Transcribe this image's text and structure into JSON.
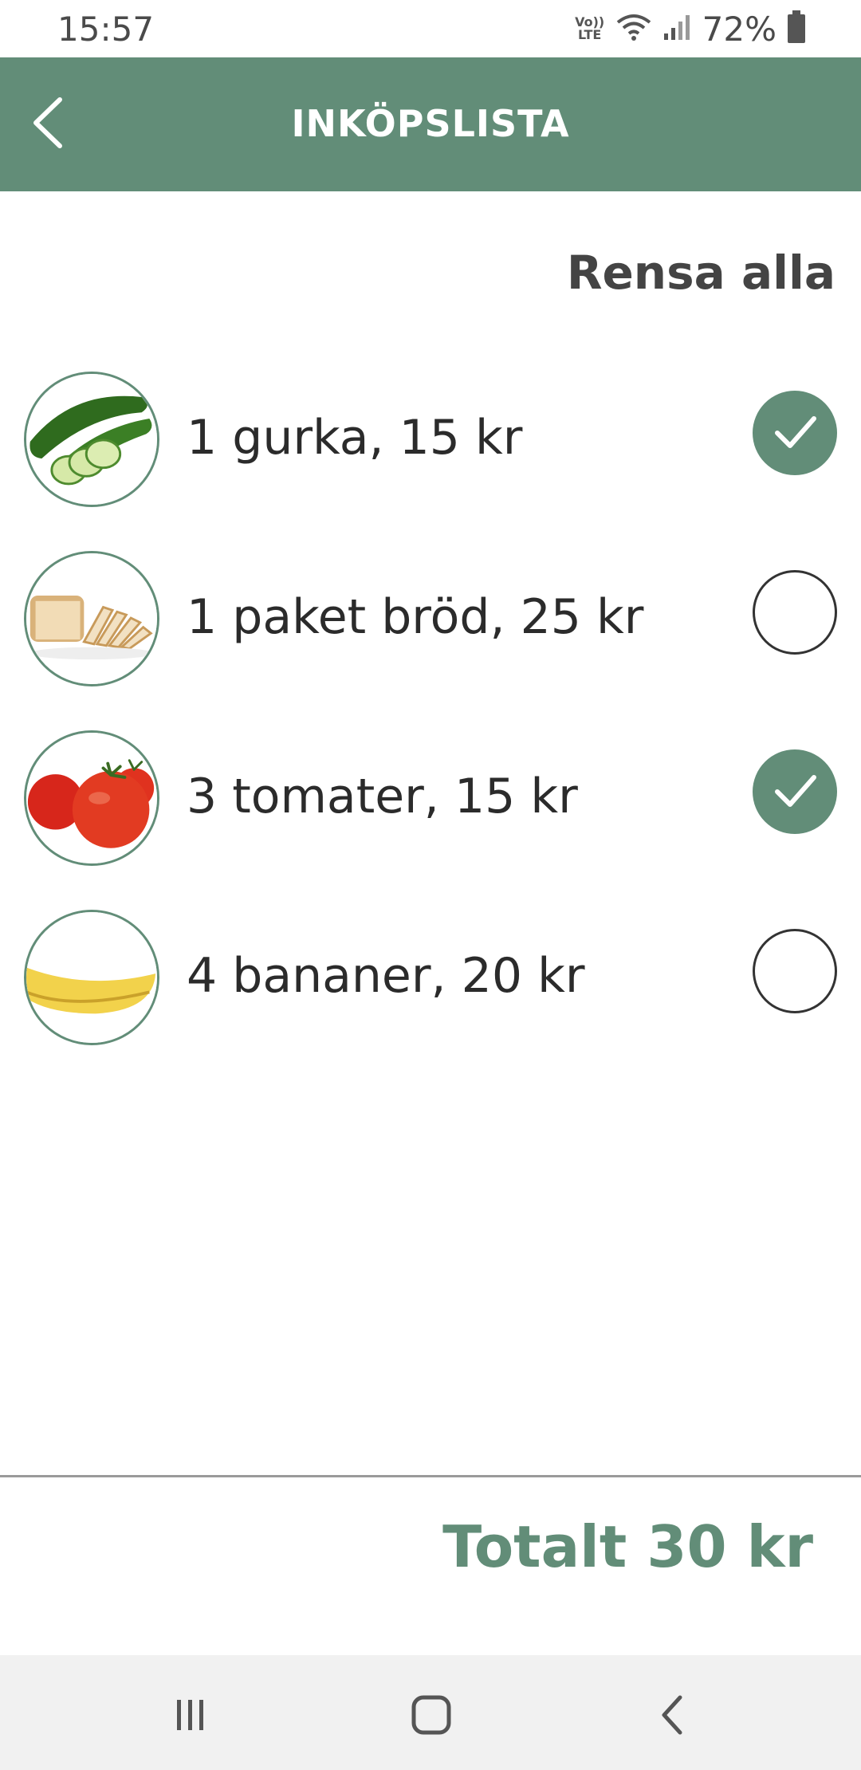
{
  "status_bar": {
    "time": "15:57",
    "network_label": "Vo)) LTE",
    "battery_percent": "72%"
  },
  "app_bar": {
    "title": "INKÖPSLISTA",
    "back_icon": "chevron-left-icon"
  },
  "clear_all_label": "Rensa alla",
  "items": [
    {
      "label": "1 gurka, 15 kr",
      "image": "cucumber",
      "checked": true
    },
    {
      "label": "1 paket bröd, 25 kr",
      "image": "bread",
      "checked": false
    },
    {
      "label": "3 tomater, 15 kr",
      "image": "tomatoes",
      "checked": true
    },
    {
      "label": "4 bananer, 20 kr",
      "image": "banana",
      "checked": false
    }
  ],
  "total_label": "Totalt 30 kr",
  "nav_bar": {
    "buttons": [
      "recent-apps-icon",
      "home-icon",
      "back-icon"
    ]
  },
  "colors": {
    "accent": "#628d78",
    "text": "#2b2b2b",
    "nav_background": "#f1f1f1"
  }
}
